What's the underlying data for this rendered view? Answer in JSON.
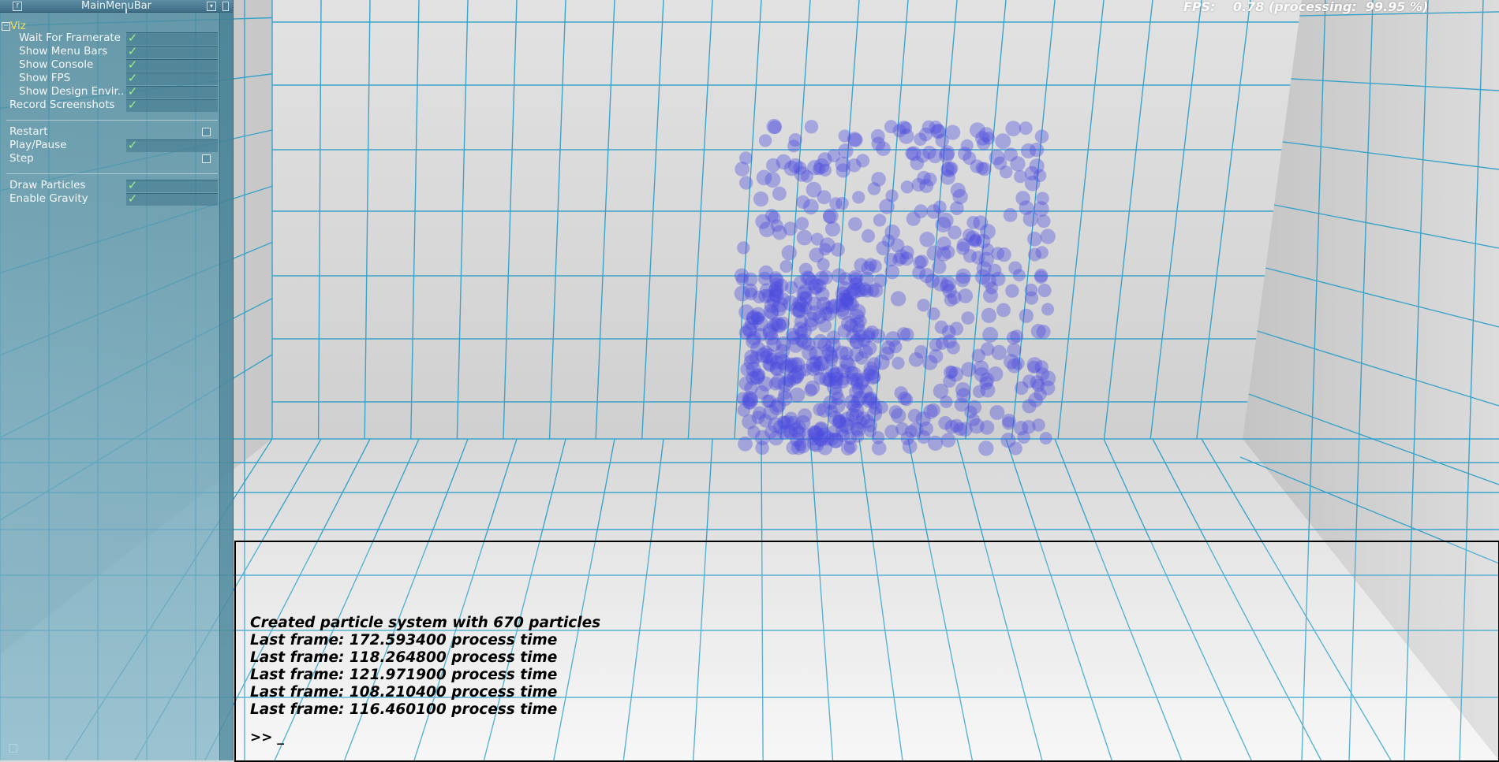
{
  "window": {
    "title": "MainMenuBar"
  },
  "menu": {
    "group_label": "Viz",
    "items": [
      {
        "label": "Wait For Framerate",
        "checked": true,
        "kind": "check"
      },
      {
        "label": "Show Menu Bars",
        "checked": true,
        "kind": "check"
      },
      {
        "label": "Show Console",
        "checked": true,
        "kind": "check"
      },
      {
        "label": "Show FPS",
        "checked": true,
        "kind": "check"
      },
      {
        "label": "Show Design Envir..",
        "checked": true,
        "kind": "check"
      },
      {
        "label": "Record Screenshots",
        "checked": true,
        "kind": "check"
      },
      {
        "label": "Restart",
        "kind": "button"
      },
      {
        "label": "Play/Pause",
        "checked": true,
        "kind": "check"
      },
      {
        "label": "Step",
        "kind": "button"
      },
      {
        "label": "Draw Particles",
        "checked": true,
        "kind": "check"
      },
      {
        "label": "Enable Gravity",
        "checked": true,
        "kind": "check"
      }
    ]
  },
  "fps": {
    "label": "FPS:",
    "value": "0.78",
    "processing_label": "(processing:",
    "processing_value": "99.95 %)"
  },
  "console": {
    "lines": [
      "Created particle system with 670 particles",
      "Last frame: 172.593400 process time",
      "Last frame: 118.264800 process time",
      "Last frame: 121.971900 process time",
      "Last frame: 108.210400 process time",
      "Last frame: 116.460100 process time"
    ],
    "prompt": ">> _"
  },
  "scene": {
    "particle_count": 670,
    "particle_color": "#4b4be0",
    "grid_color": "#2a9ec8"
  }
}
